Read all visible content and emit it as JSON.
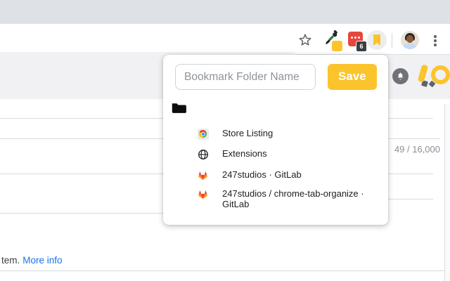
{
  "browser": {
    "omnibox_value": "",
    "extension_badge_count": "6",
    "toolbar_icons": [
      "star-icon",
      "eyedropper-icon",
      "red-extension-icon",
      "bookmark-extension-icon",
      "profile-avatar",
      "menu-icon"
    ]
  },
  "site_header": {
    "icons": [
      "notification-bell-icon",
      "site-logo-pencil-magnifier"
    ]
  },
  "popup": {
    "folder_input": {
      "value": "",
      "placeholder": "Bookmark Folder Name"
    },
    "save_button_label": "Save",
    "folder_icon": "folder-icon",
    "bookmarks": [
      {
        "icon": "chrome-store-icon",
        "title": "Store Listing"
      },
      {
        "icon": "globe-icon",
        "title": "Extensions"
      },
      {
        "icon": "gitlab-icon",
        "title": "247studios · GitLab"
      },
      {
        "icon": "gitlab-icon",
        "title": "247studios / chrome-tab-organize · GitLab"
      }
    ]
  },
  "page": {
    "char_counter": "49 / 16,000",
    "footer_text_fragment": "tem.",
    "more_info_link": "More info"
  },
  "colors": {
    "accent_yellow": "#fbc42d",
    "link_blue": "#1a73e8",
    "red_extension": "#e8453c",
    "gitlab_orange": "#fc6d26",
    "tabstrip_gray": "#dee1e6",
    "header_band_gray": "#f1f1f3"
  }
}
